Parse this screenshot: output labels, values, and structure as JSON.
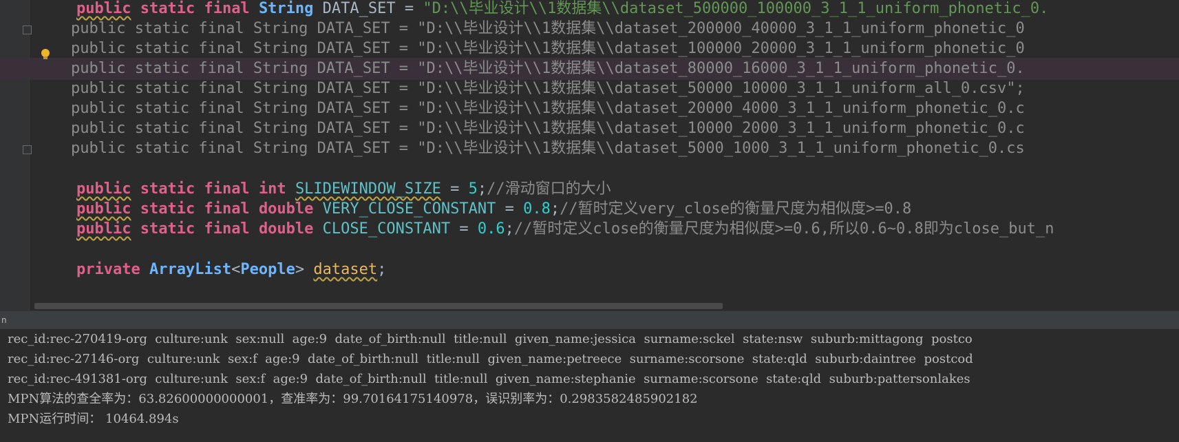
{
  "editor": {
    "lines": [
      {
        "prefix": "",
        "indent": "    ",
        "kw1": "public",
        "kw2": "static",
        "kw3": "final",
        "type": "String",
        "name": "DATA_SET",
        "op": " = ",
        "str": "\"D:\\\\毕业设计\\\\1数据集\\\\dataset_500000_100000_3_1_1_uniform_phonetic_0.",
        "commented": false
      },
      {
        "prefix": "//",
        "text": "    public static final String DATA_SET = \"D:\\\\毕业设计\\\\1数据集\\\\dataset_200000_40000_3_1_1_uniform_phonetic_0",
        "commented": true
      },
      {
        "prefix": "//",
        "text": "    public static final String DATA_SET = \"D:\\\\毕业设计\\\\1数据集\\\\dataset_100000_20000_3_1_1_uniform_phonetic_0",
        "commented": true
      },
      {
        "prefix": "//",
        "text": "    public static final String DATA_SET = \"D:\\\\毕业设计\\\\1数据集\\\\dataset_80000_16000_3_1_1_uniform_phonetic_0.",
        "commented": true
      },
      {
        "prefix": "//",
        "text": "    public static final String DATA_SET = \"D:\\\\毕业设计\\\\1数据集\\\\dataset_50000_10000_3_1_1_uniform_all_0.csv\";",
        "commented": true
      },
      {
        "prefix": "//",
        "text": "    public static final String DATA_SET = \"D:\\\\毕业设计\\\\1数据集\\\\dataset_20000_4000_3_1_1_uniform_phonetic_0.c",
        "commented": true
      },
      {
        "prefix": "//",
        "text": "    public static final String DATA_SET = \"D:\\\\毕业设计\\\\1数据集\\\\dataset_10000_2000_3_1_1_uniform_phonetic_0.c",
        "commented": true
      },
      {
        "prefix": "//",
        "text": "    public static final String DATA_SET = \"D:\\\\毕业设计\\\\1数据集\\\\dataset_5000_1000_3_1_1_uniform_phonetic_0.cs",
        "commented": true
      }
    ],
    "slide": {
      "type": "int",
      "name": "SLIDEWINDOW_SIZE",
      "value": "5",
      "comment": "//滑动窗口的大小"
    },
    "very_close": {
      "type": "double",
      "name": "VERY_CLOSE_CONSTANT",
      "value": "0.8",
      "comment": "//暂时定义very_close的衡量尺度为相似度>=0.8"
    },
    "close": {
      "type": "double",
      "name": "CLOSE_CONSTANT",
      "value": "0.6",
      "comment": "//暂时定义close的衡量尺度为相似度>=0.6,所以0.6~0.8即为close_but_n"
    },
    "dataset_decl": {
      "kw": "private",
      "type": "ArrayList",
      "generic": "People",
      "name": "dataset"
    },
    "kw_public": "public",
    "kw_static": "static",
    "kw_final": "final"
  },
  "console_header": {
    "label": "n"
  },
  "console": {
    "lines": [
      "rec_id:rec-270419-org  culture:unk  sex:null  age:9  date_of_birth:null  title:null  given_name:jessica  surname:sckel  state:nsw  suburb:mittagong  postco",
      "rec_id:rec-27146-org  culture:unk  sex:f  age:9  date_of_birth:null  title:null  given_name:petreece  surname:scorsone  state:qld  suburb:daintree  postcod",
      "rec_id:rec-491381-org  culture:unk  sex:f  age:9  date_of_birth:null  title:null  given_name:stephanie  surname:scorsone  state:qld  suburb:pattersonlakes",
      "MPN算法的查全率为：63.82600000000001，查准率为：99.70164175140978，误识别率为：0.2983582485902182",
      "MPN运行时间： 10464.894s"
    ]
  },
  "colors": {
    "bg": "#2b2b2b",
    "keyword": "#e0608a",
    "string": "#629755",
    "number": "#2fd0d0",
    "comment": "#8c8c8c"
  }
}
